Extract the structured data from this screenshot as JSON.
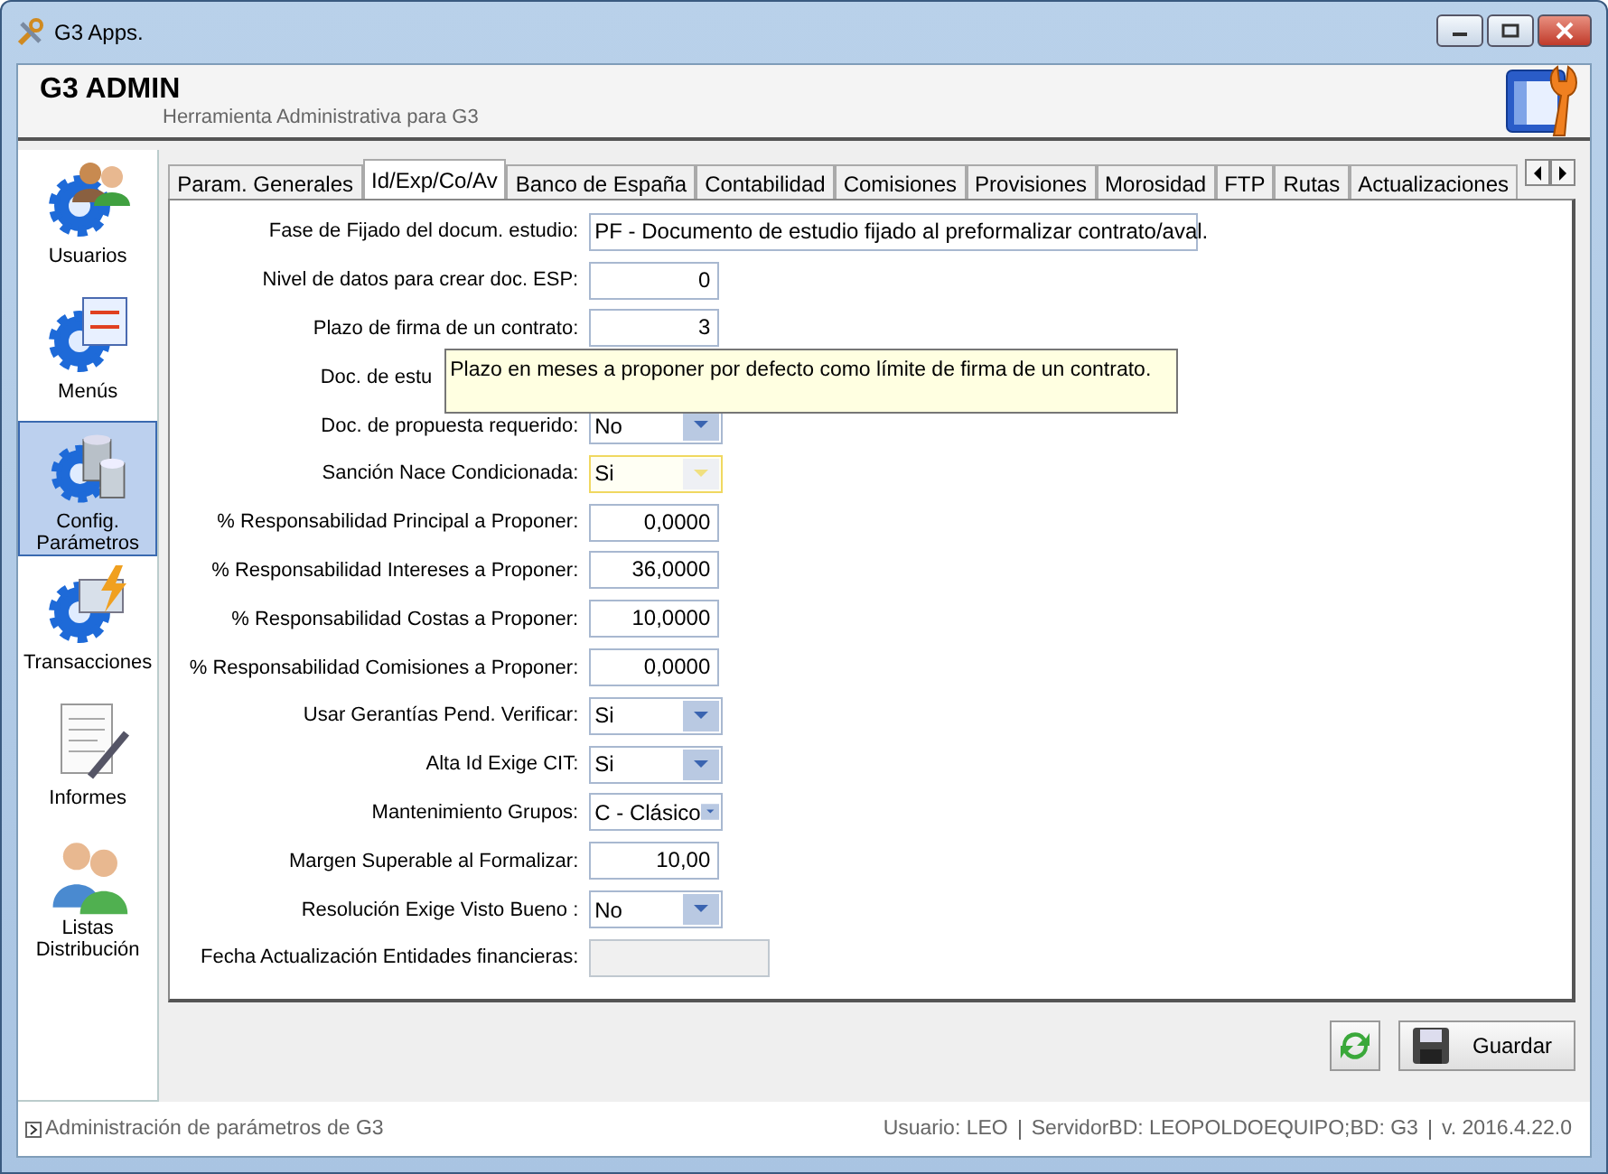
{
  "window": {
    "title": "G3 Apps."
  },
  "header": {
    "title": "G3 ADMIN",
    "subtitle": "Herramienta Administrativa para G3"
  },
  "sidebar": {
    "items": [
      {
        "label": "Usuarios",
        "selected": false
      },
      {
        "label": "Menús",
        "selected": false
      },
      {
        "label": "Config. Parámetros",
        "selected": true
      },
      {
        "label": "Transacciones",
        "selected": false
      },
      {
        "label": "Informes",
        "selected": false
      },
      {
        "label": "Listas Distribución",
        "selected": false
      }
    ]
  },
  "tabs": [
    {
      "label": "Param. Generales",
      "selected": false
    },
    {
      "label": "Id/Exp/Co/Av",
      "selected": true
    },
    {
      "label": "Banco de España",
      "selected": false
    },
    {
      "label": "Contabilidad",
      "selected": false
    },
    {
      "label": "Comisiones",
      "selected": false
    },
    {
      "label": "Provisiones",
      "selected": false
    },
    {
      "label": "Morosidad",
      "selected": false
    },
    {
      "label": "FTP",
      "selected": false
    },
    {
      "label": "Rutas",
      "selected": false
    },
    {
      "label": "Actualizaciones",
      "selected": false
    }
  ],
  "fields": [
    {
      "label": "Fase de Fijado del docum. estudio:",
      "kind": "combo",
      "wide": true,
      "value": "PF - Documento de estudio fijado al preformalizar contrato/aval.",
      "highlighted": false
    },
    {
      "label": "Nivel de datos para crear doc. ESP:",
      "kind": "number",
      "value": "0",
      "highlighted": false
    },
    {
      "label": "Plazo de firma de un contrato:",
      "kind": "number",
      "value": "3",
      "highlighted": false
    },
    {
      "label": "Doc. de estu",
      "kind": "covered"
    },
    {
      "label": "Doc. de propuesta requerido:",
      "kind": "combo",
      "value": "No",
      "highlighted": false
    },
    {
      "label": "Sanción Nace Condicionada:",
      "kind": "combo",
      "value": "Si",
      "highlighted": true
    },
    {
      "label": "% Responsabilidad Principal a Proponer:",
      "kind": "number",
      "value": "0,0000",
      "highlighted": false
    },
    {
      "label": "% Responsabilidad Intereses a Proponer:",
      "kind": "number",
      "value": "36,0000",
      "highlighted": false
    },
    {
      "label": "% Responsabilidad Costas a Proponer:",
      "kind": "number",
      "value": "10,0000",
      "highlighted": false
    },
    {
      "label": "% Responsabilidad Comisiones a Proponer:",
      "kind": "number",
      "value": "0,0000",
      "highlighted": false
    },
    {
      "label": "Usar Gerantías Pend. Verificar:",
      "kind": "combo",
      "value": "Si",
      "highlighted": false
    },
    {
      "label": "Alta Id Exige CIT:",
      "kind": "combo",
      "value": "Si",
      "highlighted": false
    },
    {
      "label": "Mantenimiento Grupos:",
      "kind": "combo",
      "value": "C - Clásico",
      "highlighted": false
    },
    {
      "label": "Margen Superable al Formalizar:",
      "kind": "number",
      "value": "10,00",
      "highlighted": false
    },
    {
      "label": "Resolución Exige Visto Bueno :",
      "kind": "combo",
      "value": "No",
      "highlighted": false
    },
    {
      "label": "Fecha Actualización Entidades financieras:",
      "kind": "disabled",
      "highlighted": false
    }
  ],
  "tooltip": "Plazo en meses a proponer por defecto como límite de firma de un contrato.",
  "buttons": {
    "save": "Guardar"
  },
  "status_bar": {
    "message": "Administración de parámetros de G3",
    "items": [
      "Usuario: LEO",
      "ServidorBD: LEOPOLDOEQUIPO;BD: G3",
      "v. 2016.4.22.0"
    ]
  }
}
